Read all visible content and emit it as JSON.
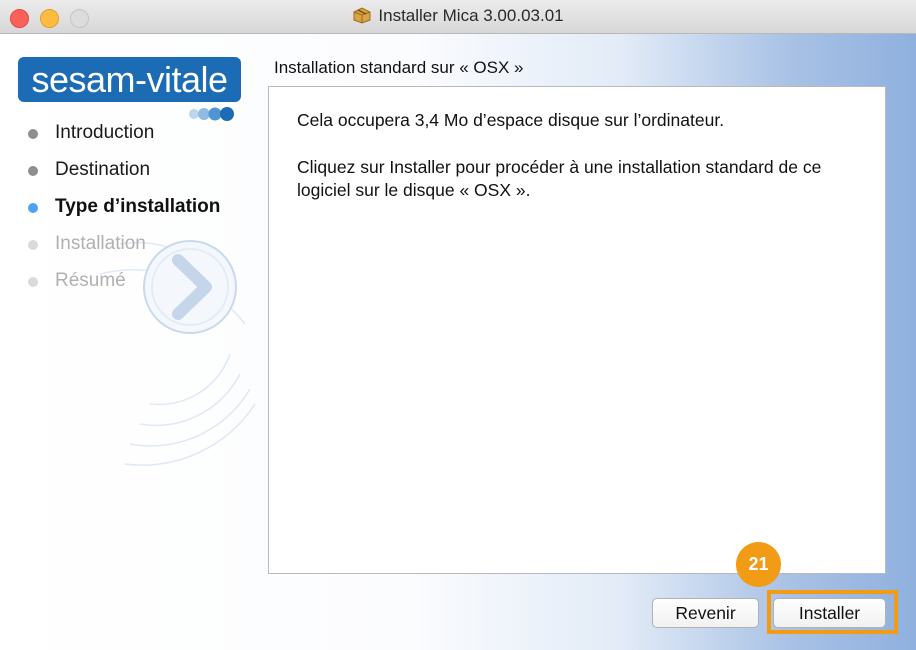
{
  "window": {
    "title": "Installer Mica 3.00.03.01",
    "icon": "package-icon"
  },
  "logo": {
    "text": "sesam-vitale"
  },
  "sidebar": {
    "steps": [
      {
        "label": "Introduction",
        "state": "done"
      },
      {
        "label": "Destination",
        "state": "done"
      },
      {
        "label": "Type d’installation",
        "state": "current"
      },
      {
        "label": "Installation",
        "state": "pending"
      },
      {
        "label": "Résumé",
        "state": "pending"
      }
    ]
  },
  "main": {
    "section_title": "Installation standard sur « OSX »",
    "paragraph_space": "Cela occupera 3,4 Mo d’espace disque sur l’ordinateur.",
    "paragraph_info": "Cliquez sur Installer pour procéder à une installation standard de ce logiciel sur le disque « OSX »."
  },
  "buttons": {
    "back_label": "Revenir",
    "install_label": "Installer"
  },
  "annotation": {
    "badge_number": "21",
    "color": "#f29b15"
  },
  "colors": {
    "accent_blue": "#4aa2f0",
    "logo_blue": "#1b6bb5"
  }
}
